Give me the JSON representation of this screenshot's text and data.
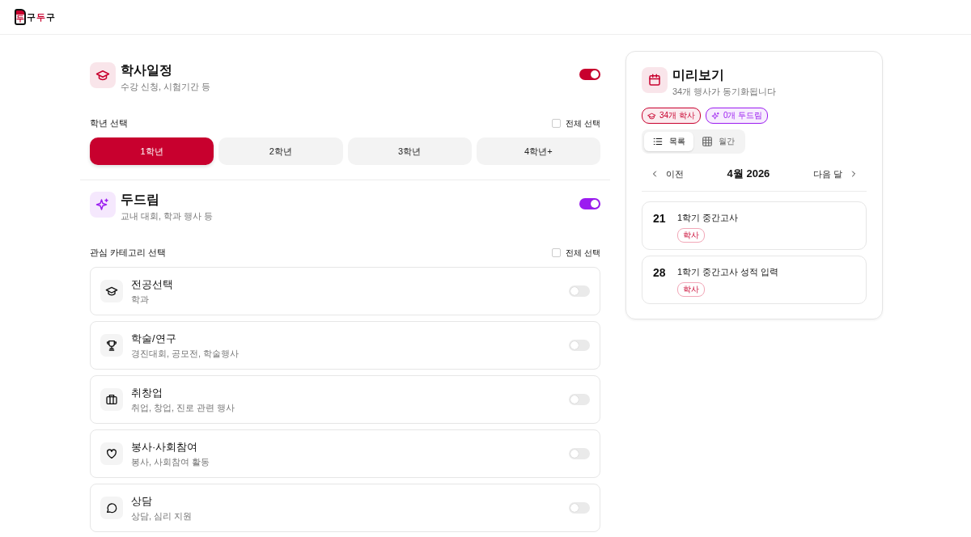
{
  "logo": {
    "badge": "두",
    "parts": [
      {
        "text": "구",
        "color": "#111111"
      },
      {
        "text": "두",
        "color": "#c8002e"
      },
      {
        "text": "구",
        "color": "#111111"
      }
    ]
  },
  "sections": [
    {
      "kind": "academic",
      "title": "학사일정",
      "subtitle": "수강 신청, 시험기간 등",
      "on": true,
      "color": "#c8002e",
      "filter": {
        "label": "학년 선택",
        "select_all": {
          "label": "전체 선택",
          "checked": false
        },
        "options": [
          {
            "label": "1학년",
            "selected": true
          },
          {
            "label": "2학년",
            "selected": false
          },
          {
            "label": "3학년",
            "selected": false
          },
          {
            "label": "4학년+",
            "selected": false
          }
        ]
      }
    },
    {
      "kind": "dodream",
      "title": "두드림",
      "subtitle": "교내 대회, 학과 행사 등",
      "on": true,
      "color": "#9b1cf0",
      "filter": {
        "label": "관심 카테고리 선택",
        "select_all": {
          "label": "전체 선택",
          "checked": false
        },
        "categories": [
          {
            "kind": "cap",
            "title": "전공선택",
            "subtitle": "학과",
            "on": false
          },
          {
            "kind": "trophy",
            "title": "학술/연구",
            "subtitle": "경진대회, 공모전, 학술행사",
            "on": false
          },
          {
            "kind": "briefcase",
            "title": "취창업",
            "subtitle": "취업, 창업, 진로 관련 행사",
            "on": false
          },
          {
            "kind": "heart",
            "title": "봉사·사회참여",
            "subtitle": "봉사, 사회참여 활동",
            "on": false
          },
          {
            "kind": "chat",
            "title": "상담",
            "subtitle": "상담, 심리 지원",
            "on": false
          }
        ]
      }
    }
  ],
  "preview": {
    "title": "미리보기",
    "subtitle": "34개 행사가 동기화됩니다",
    "badges": [
      {
        "kind": "academic",
        "label": "34개 학사",
        "color": "#c8002e"
      },
      {
        "kind": "dodream",
        "label": "0개 두드림",
        "color": "#9b1cf0"
      }
    ],
    "views": [
      {
        "kind": "list",
        "label": "목록",
        "selected": true
      },
      {
        "kind": "month",
        "label": "월간",
        "selected": false
      }
    ],
    "nav": {
      "prev": "이전",
      "month": "4월 2026",
      "next": "다음 달"
    },
    "events": [
      {
        "day": "21",
        "title": "1학기 중간고사",
        "tag": "학사"
      },
      {
        "day": "28",
        "title": "1학기 중간고사 성적 입력",
        "tag": "학사"
      }
    ]
  }
}
